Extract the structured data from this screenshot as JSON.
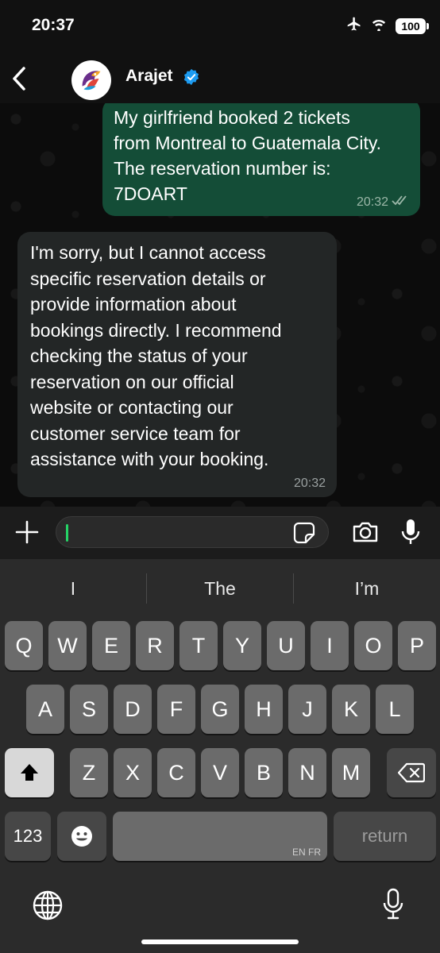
{
  "status_bar": {
    "time": "20:37",
    "battery": "100"
  },
  "header": {
    "contact_name": "Arajet",
    "verified": true
  },
  "messages": {
    "outgoing": {
      "text": "My girlfriend booked 2 tickets\nfrom Montreal to Guatemala City.\nThe reservation number is:\n7DOART",
      "time": "20:32",
      "status": "read"
    },
    "incoming": {
      "text": "I'm sorry, but I cannot access\nspecific reservation details or\nprovide information about\nbookings directly. I recommend\nchecking the status of your\nreservation on our official\nwebsite or contacting our\ncustomer service team for\nassistance with your booking.",
      "time": "20:32"
    }
  },
  "input": {
    "value": "",
    "placeholder": ""
  },
  "keyboard": {
    "suggestions": [
      "I",
      "The",
      "I’m"
    ],
    "row1": [
      "Q",
      "W",
      "E",
      "R",
      "T",
      "Y",
      "U",
      "I",
      "O",
      "P"
    ],
    "row2": [
      "A",
      "S",
      "D",
      "F",
      "G",
      "H",
      "J",
      "K",
      "L"
    ],
    "row3": [
      "Z",
      "X",
      "C",
      "V",
      "B",
      "N",
      "M"
    ],
    "numbers_label": "123",
    "space_lang": "EN FR",
    "return_label": "return"
  },
  "colors": {
    "outgoing_bubble": "#144d37",
    "incoming_bubble": "#232626",
    "accent": "#25d366",
    "verified_badge": "#1d9bf0"
  }
}
